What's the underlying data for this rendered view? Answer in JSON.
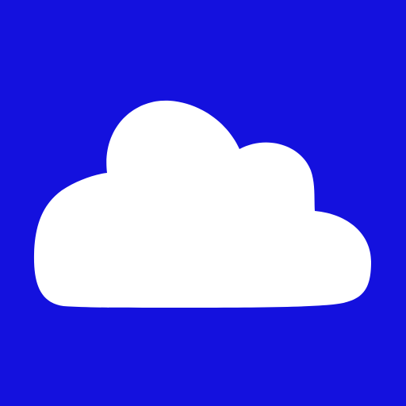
{
  "icon": {
    "name": "cloud-icon",
    "background_color": "#1411DE",
    "cloud_color": "#FFFFFF"
  }
}
